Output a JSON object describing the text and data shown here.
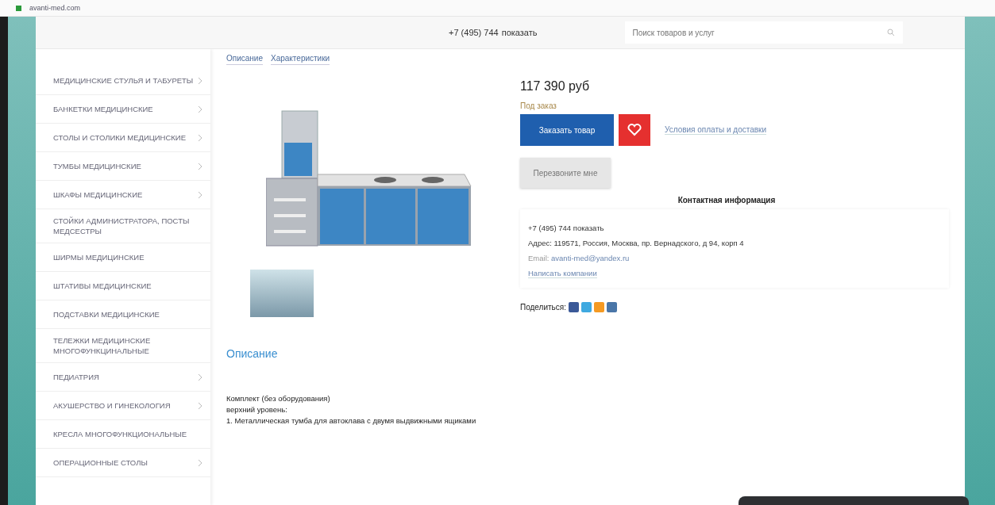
{
  "browser": {
    "address": "avanti-med.com"
  },
  "header": {
    "phone": "+7 (495) 744",
    "show_link": "показать",
    "search": {
      "placeholder": "Поиск товаров и услуг"
    }
  },
  "sidebar": {
    "items": [
      {
        "label": "МЕДИЦИНСКИЕ СТУЛЬЯ И ТАБУРЕТЫ",
        "expandable": true
      },
      {
        "label": "БАНКЕТКИ МЕДИЦИНСКИЕ",
        "expandable": true
      },
      {
        "label": "СТОЛЫ И СТОЛИКИ МЕДИЦИНСКИЕ",
        "expandable": true
      },
      {
        "label": "ТУМБЫ МЕДИЦИНСКИЕ",
        "expandable": true
      },
      {
        "label": "ШКАФЫ МЕДИЦИНСКИЕ",
        "expandable": true
      },
      {
        "label": "СТОЙКИ АДМИНИСТРАТОРА, ПОСТЫ МЕДСЕСТРЫ",
        "expandable": false
      },
      {
        "label": "ШИРМЫ МЕДИЦИНСКИЕ",
        "expandable": false
      },
      {
        "label": "ШТАТИВЫ МЕДИЦИНСКИЕ",
        "expandable": false
      },
      {
        "label": "ПОДСТАВКИ МЕДИЦИНСКИЕ",
        "expandable": false
      },
      {
        "label": "ТЕЛЕЖКИ МЕДИЦИНСКИЕ МНОГОФУНКЦИНАЛЬНЫЕ",
        "expandable": false
      },
      {
        "label": "ПЕДИАТРИЯ",
        "expandable": true
      },
      {
        "label": "АКУШЕРСТВО И ГИНЕКОЛОГИЯ",
        "expandable": true
      },
      {
        "label": "КРЕСЛА МНОГОФУНКЦИОНАЛЬНЫЕ",
        "expandable": false
      },
      {
        "label": "ОПЕРАЦИОННЫЕ СТОЛЫ",
        "expandable": true
      }
    ]
  },
  "tabs": [
    {
      "label": "Описание"
    },
    {
      "label": "Характеристики"
    }
  ],
  "product": {
    "price": "117 390 руб",
    "availability": "Под заказ",
    "order_button": "Заказать товар",
    "delivery_link": "Условия оплаты и доставки",
    "callback_button": "Перезвоните мне",
    "contact": {
      "title": "Контактная информация",
      "phone": "+7 (495) 744",
      "show_link": "показать",
      "address": "Адрес: 119571, Россия, Москва, пр. Вернадского, д 94, корп 4",
      "email_label": "Email:",
      "email": "avanti-med@yandex.ru",
      "write_link": "Написать компании"
    },
    "share_label": "Поделиться:"
  },
  "description": {
    "title": "Описание",
    "lines": [
      "Комплект (без оборудования)",
      "верхний уровень:",
      "1. Металлическая тумба для автоклава с двумя выдвижными ящиками"
    ]
  }
}
